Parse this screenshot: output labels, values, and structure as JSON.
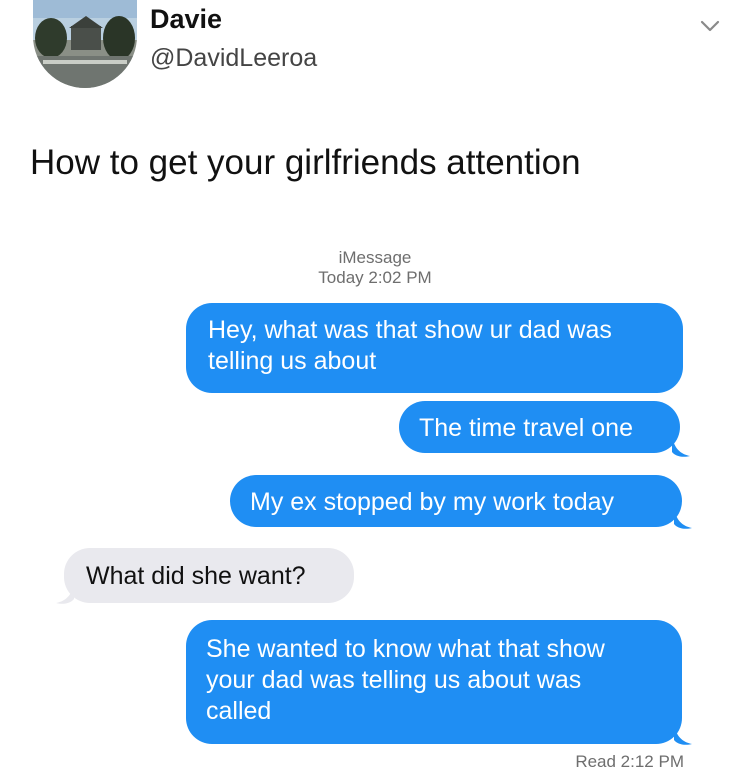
{
  "tweet": {
    "display_name": "Davie",
    "handle": "@DavidLeeroa",
    "text": "How to get your girlfriends attention"
  },
  "conversation": {
    "service": "iMessage",
    "timestamp": "Today 2:02 PM",
    "messages": [
      {
        "sender": "me",
        "lines": [
          "Hey, what was that show ur dad was",
          "telling us about"
        ]
      },
      {
        "sender": "me",
        "lines": [
          "The time travel one"
        ]
      },
      {
        "sender": "me",
        "lines": [
          "My ex stopped by my work today"
        ]
      },
      {
        "sender": "them",
        "lines": [
          "What did she want?"
        ]
      },
      {
        "sender": "me",
        "lines": [
          "She wanted to know what that show",
          "your dad was telling us about was",
          "called"
        ]
      }
    ],
    "read_receipt": "Read 2:12 PM"
  },
  "colors": {
    "sent_bubble": "#1f8ef3",
    "received_bubble": "#e9e9ee"
  },
  "icons": {
    "menu": "chevron-down-icon",
    "avatar": "profile-photo"
  }
}
